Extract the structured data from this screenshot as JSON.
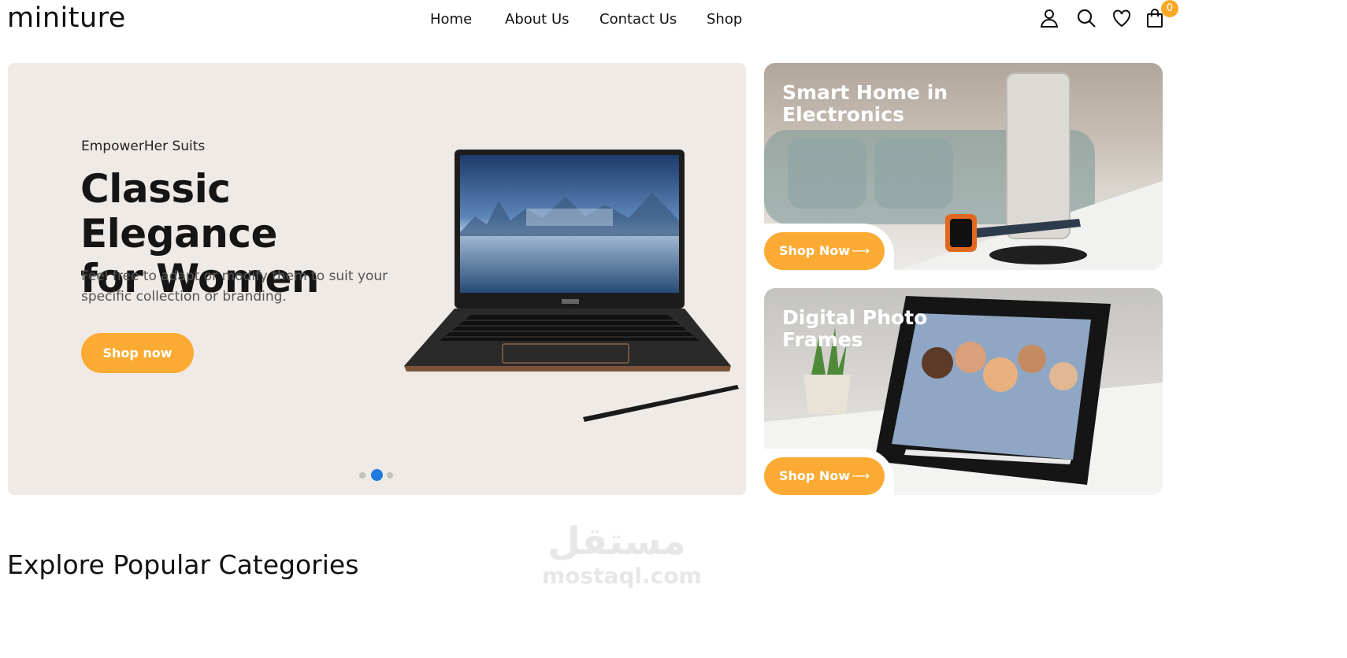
{
  "header": {
    "logo": "miniture",
    "nav": [
      "Home",
      "About Us",
      "Contact Us",
      "Shop"
    ],
    "icons": [
      "user-icon",
      "search-icon",
      "heart-icon",
      "bag-icon"
    ],
    "cart_count": "0"
  },
  "hero": {
    "eyebrow": "EmpowerHer Suits",
    "title_line1": "Classic Elegance",
    "title_line2": "for Women",
    "description": "Feel free to adapt or modify them to suit your specific collection or branding.",
    "button": "Shop now",
    "slide_count": 3,
    "active_slide": 2
  },
  "cards": [
    {
      "title_line1": "Smart Home in",
      "title_line2": "Electronics",
      "button": "Shop Now"
    },
    {
      "title_line1": "Digital Photo",
      "title_line2": "Frames",
      "button": "Shop Now"
    }
  ],
  "section": {
    "title": "Explore Popular Categories"
  },
  "watermark": {
    "arabic": "مستقل",
    "latin": "mostaql.com"
  },
  "colors": {
    "accent": "#fbab34",
    "badge": "#f9a825",
    "dot_active": "#1f7ae0",
    "hero_bg": "#efeae5"
  }
}
